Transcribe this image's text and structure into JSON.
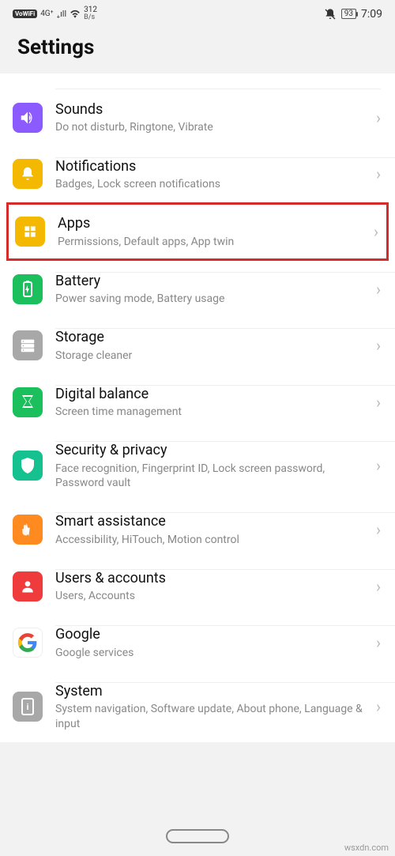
{
  "status": {
    "vowifi": "VoWiFi",
    "net_gen": "4G⁺",
    "speed_top": "312",
    "speed_bot": "B/s",
    "battery": "93",
    "time": "7:09"
  },
  "header": {
    "title": "Settings"
  },
  "items": [
    {
      "title": "Sounds",
      "subtitle": "Do not disturb, Ringtone, Vibrate",
      "color": "#8c5bff"
    },
    {
      "title": "Notifications",
      "subtitle": "Badges, Lock screen notifications",
      "color": "#f5b800"
    },
    {
      "title": "Apps",
      "subtitle": "Permissions, Default apps, App twin",
      "color": "#f5b800"
    },
    {
      "title": "Battery",
      "subtitle": "Power saving mode, Battery usage",
      "color": "#1bbf5c"
    },
    {
      "title": "Storage",
      "subtitle": "Storage cleaner",
      "color": "#a8a8a8"
    },
    {
      "title": "Digital balance",
      "subtitle": "Screen time management",
      "color": "#1bbf5c"
    },
    {
      "title": "Security & privacy",
      "subtitle": "Face recognition, Fingerprint ID, Lock screen password, Password vault",
      "color": "#14c18f"
    },
    {
      "title": "Smart assistance",
      "subtitle": "Accessibility, HiTouch, Motion control",
      "color": "#ff8a1f"
    },
    {
      "title": "Users & accounts",
      "subtitle": "Users, Accounts",
      "color": "#ef3b3b"
    },
    {
      "title": "Google",
      "subtitle": "Google services",
      "color": "#ffffff"
    },
    {
      "title": "System",
      "subtitle": "System navigation, Software update, About phone, Language & input",
      "color": "#a8a8a8"
    }
  ],
  "watermark": "wsxdn.com"
}
